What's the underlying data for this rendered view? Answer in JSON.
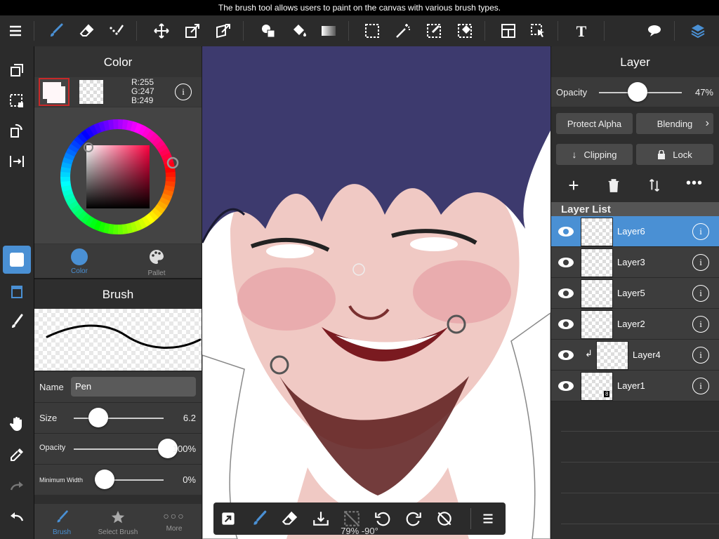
{
  "tooltip": "The brush tool allows users to paint on the canvas with various brush types.",
  "color_panel": {
    "title": "Color",
    "rgb": {
      "r": "R:255",
      "g": "G:247",
      "b": "B:249"
    },
    "tabs": [
      {
        "label": "Color"
      },
      {
        "label": "Pallet"
      }
    ],
    "active_color": "#fff7f9"
  },
  "brush_panel": {
    "title": "Brush",
    "name_label": "Name",
    "name_value": "Pen",
    "size_label": "Size",
    "size_value": "6.2",
    "size_level": 0.12,
    "opacity_label": "Opacity",
    "opacity_value": "100%",
    "opacity_level": 1.0,
    "minwidth_label": "Minimum Width",
    "minwidth_value": "0%",
    "minwidth_level": 0.0,
    "tabs": [
      {
        "label": "Brush"
      },
      {
        "label": "Select Brush"
      },
      {
        "label": "More"
      }
    ]
  },
  "layer_panel": {
    "title": "Layer",
    "opacity_label": "Opacity",
    "opacity_value": "47%",
    "opacity_level": 0.47,
    "protect_alpha": "Protect Alpha",
    "blending": "Blending",
    "clipping": "Clipping",
    "lock": "Lock",
    "list_title": "Layer List",
    "layers": [
      {
        "name": "Layer6",
        "selected": true
      },
      {
        "name": "Layer3"
      },
      {
        "name": "Layer5"
      },
      {
        "name": "Layer2"
      },
      {
        "name": "Layer4",
        "clipped": true
      },
      {
        "name": "Layer1",
        "badge": "8"
      }
    ]
  },
  "canvas_bar": {
    "zoom": "79% -90°"
  },
  "colors": {
    "accent": "#4a90d4",
    "panel": "#333333",
    "toolbar": "#2b2b2b"
  }
}
